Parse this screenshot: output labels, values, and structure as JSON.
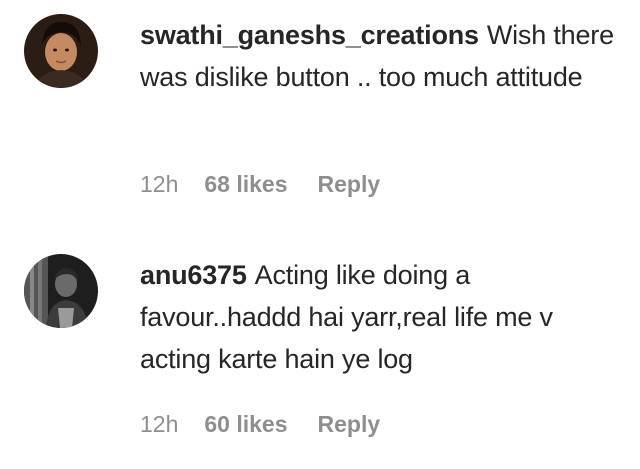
{
  "comments": [
    {
      "username": "swathi_ganeshs_creations",
      "text": "Wish there was dislike button .. too much attitude",
      "time": "12h",
      "likes": "68 likes",
      "reply_label": "Reply"
    },
    {
      "username": "anu6375",
      "text": "Acting like doing a favour..haddd hai yarr,real life me v acting karte hain ye log",
      "time": "12h",
      "likes": "60 likes",
      "reply_label": "Reply"
    }
  ],
  "colors": {
    "text_primary": "#262626",
    "text_secondary": "#8e8e8e",
    "background": "#ffffff"
  }
}
